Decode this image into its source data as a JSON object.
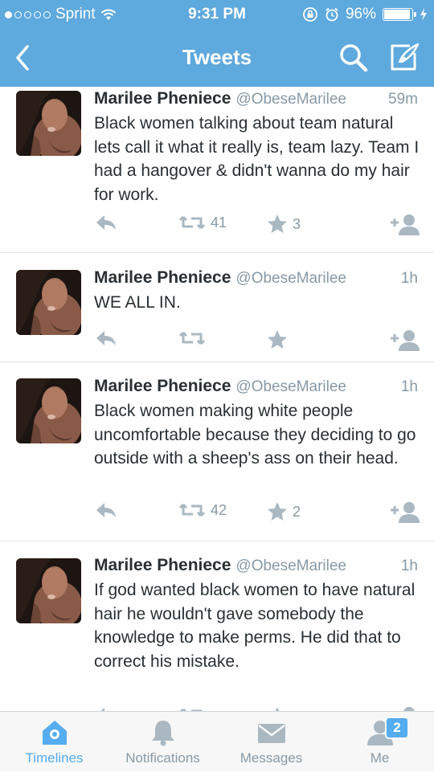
{
  "status_bar": {
    "carrier": "Sprint",
    "time": "9:31 PM",
    "battery_percent": "96%",
    "battery_level": 0.96,
    "signal_bars_filled": 1,
    "signal_bars_total": 5
  },
  "nav": {
    "title": "Tweets",
    "back_icon": "chevron-left-icon",
    "search_icon": "search-icon",
    "compose_icon": "compose-icon"
  },
  "tweets": [
    {
      "author": "Marilee Pheniece",
      "handle": "@ObeseMarilee",
      "time": "59m",
      "text": "Black women talking about team natural lets call it what it really is, team lazy. Team I had a hangover & didn't wanna do my hair for work.",
      "retweets": "41",
      "favorites": "3"
    },
    {
      "author": "Marilee Pheniece",
      "handle": "@ObeseMarilee",
      "time": "1h",
      "text": "WE ALL IN.",
      "retweets": "",
      "favorites": ""
    },
    {
      "author": "Marilee Pheniece",
      "handle": "@ObeseMarilee",
      "time": "1h",
      "text": "Black women making white people uncomfortable because they deciding to go outside with a sheep's ass on their head.",
      "retweets": "42",
      "favorites": "2"
    },
    {
      "author": "Marilee Pheniece",
      "handle": "@ObeseMarilee",
      "time": "1h",
      "text": "If god wanted black women to have natural hair he wouldn't gave somebody the knowledge to make perms. He did that to correct his mistake.",
      "retweets": "",
      "favorites": ""
    }
  ],
  "tabs": [
    {
      "label": "Timelines",
      "icon": "home-icon",
      "active": true
    },
    {
      "label": "Notifications",
      "icon": "bell-icon",
      "active": false
    },
    {
      "label": "Messages",
      "icon": "envelope-icon",
      "active": false
    },
    {
      "label": "Me",
      "icon": "person-icon",
      "active": false
    }
  ],
  "me_badge": "2",
  "colors": {
    "twitter_blue": "#5ea9dd",
    "accent": "#55acee",
    "text": "#292f33",
    "secondary_text": "#8899a6",
    "icon_gray": "#aab8c2"
  }
}
